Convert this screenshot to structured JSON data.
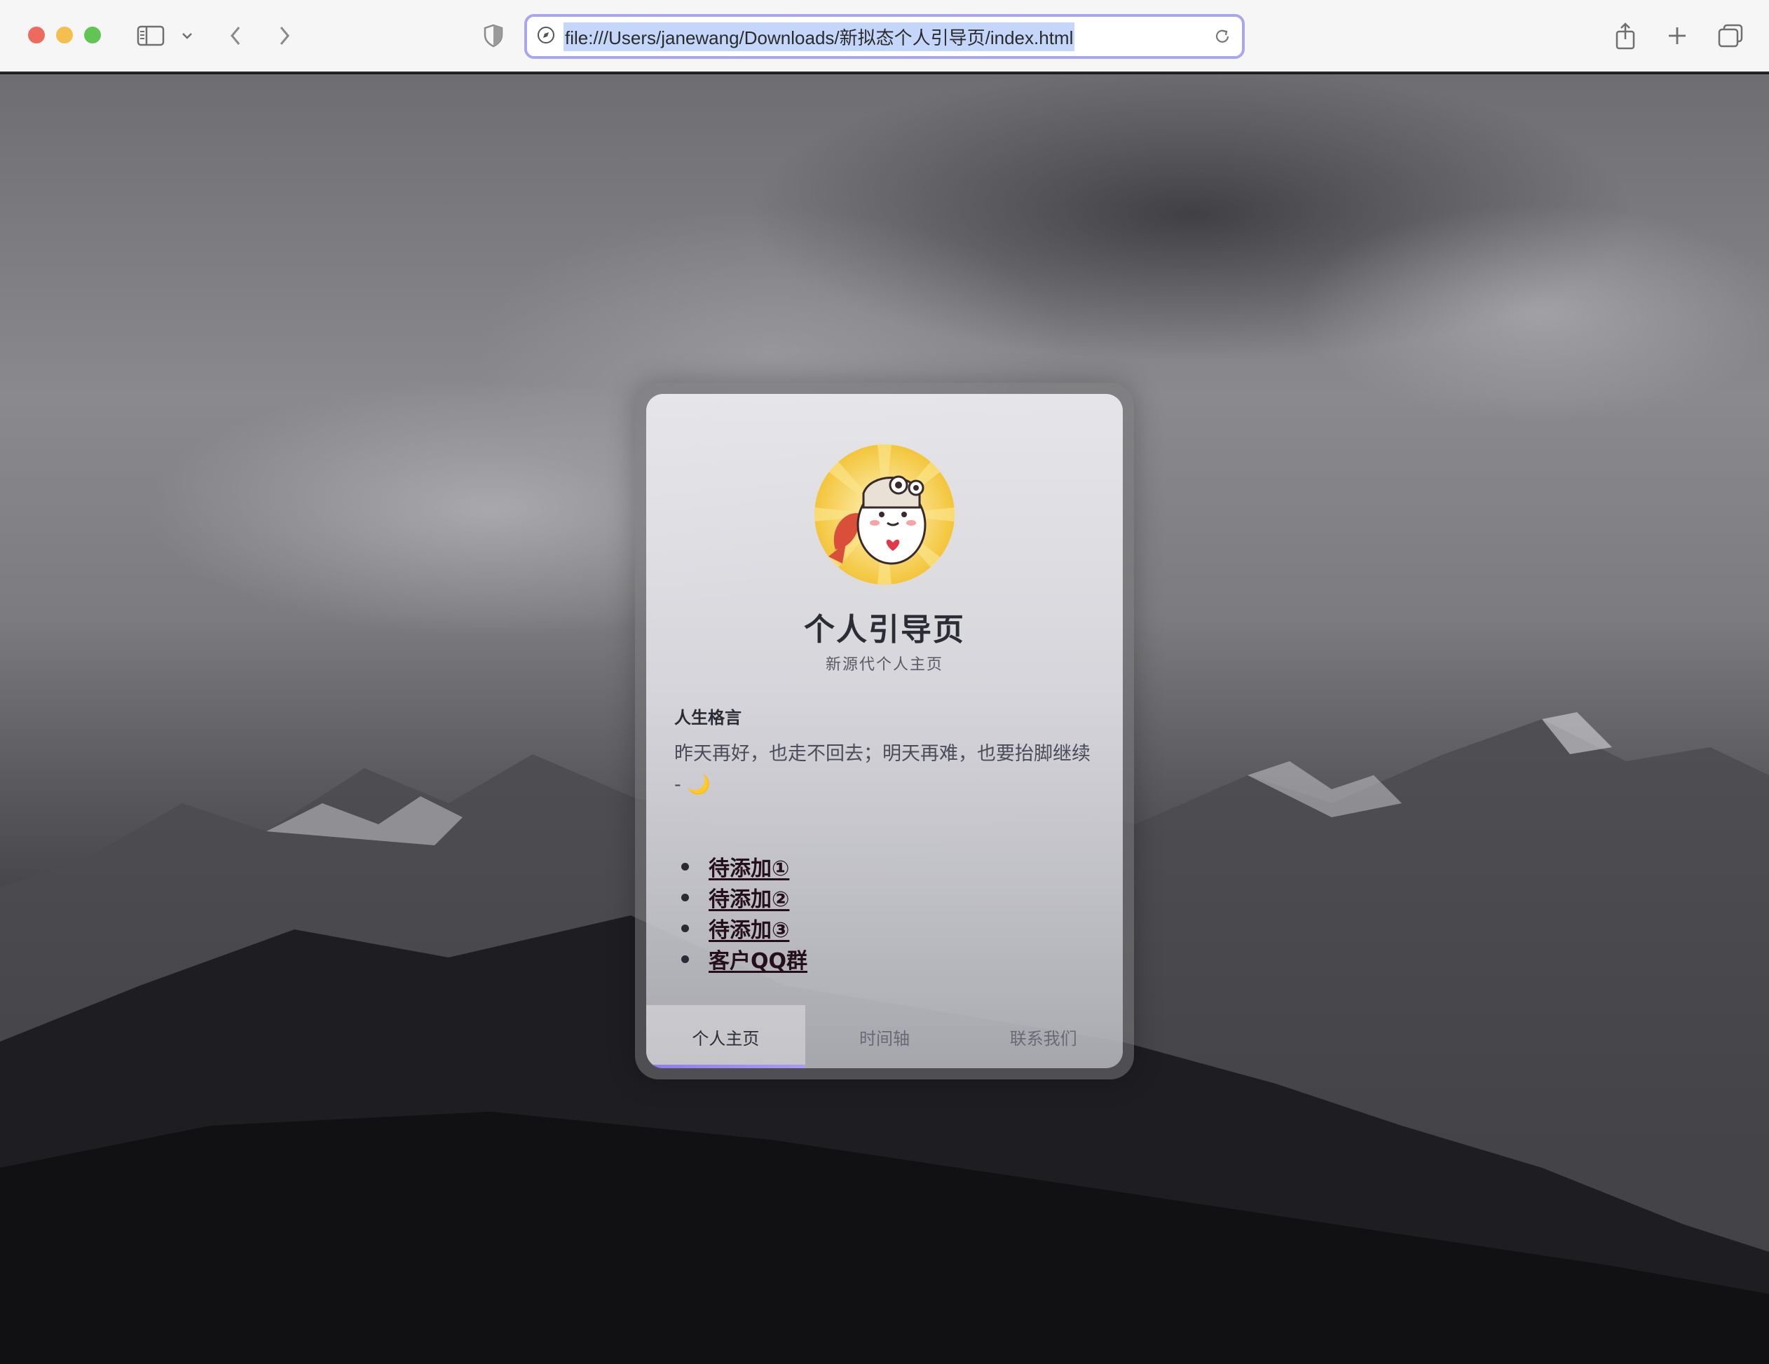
{
  "browser": {
    "url": "file:///Users/janewang/Downloads/新拟态个人引导页/index.html",
    "icons": {
      "sidebar": "sidebar-icon",
      "back": "chevron-left-icon",
      "forward": "chevron-right-icon",
      "privacy": "shield-icon",
      "site": "compass-icon",
      "reload": "reload-icon",
      "share": "share-icon",
      "new_tab": "plus-icon",
      "tab_overview": "tabs-icon"
    }
  },
  "card": {
    "title": "个人引导页",
    "subtitle": "新源代个人主页",
    "motto_heading": "人生格言",
    "motto_text": "昨天再好，也走不回去；明天再难，也要抬脚继续 - ",
    "motto_emoji": "🌙",
    "links": [
      {
        "label": "待添加①"
      },
      {
        "label": "待添加②"
      },
      {
        "label": "待添加③"
      },
      {
        "label": "客户QQ群"
      }
    ],
    "tabs": [
      {
        "label": "个人主页",
        "active": true
      },
      {
        "label": "时间轴",
        "active": false
      },
      {
        "label": "联系我们",
        "active": false
      }
    ],
    "accent_color": "#8c7cf0"
  }
}
